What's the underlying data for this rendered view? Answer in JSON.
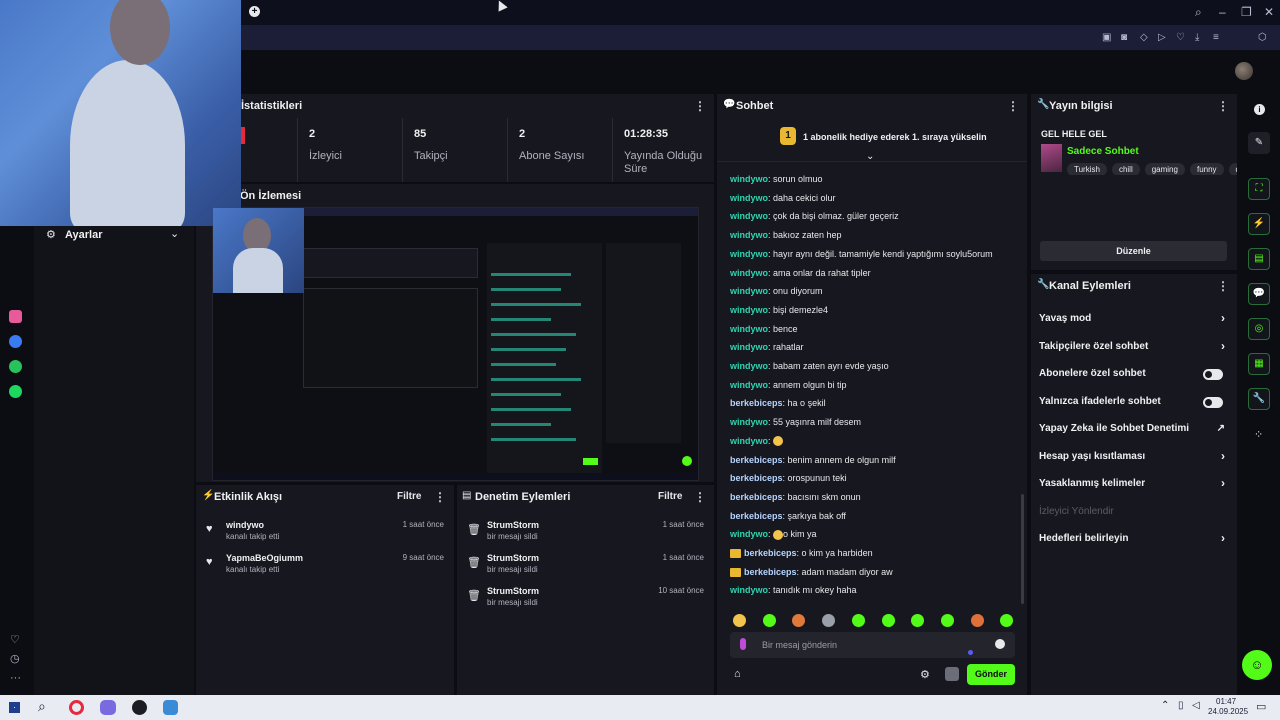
{
  "stats": {
    "title": "İstatistikleri",
    "items": [
      {
        "value": "2",
        "label": "İzleyici"
      },
      {
        "value": "85",
        "label": "Takipçi"
      },
      {
        "value": "2",
        "label": "Abone Sayısı"
      },
      {
        "value": "01:28:35",
        "label": "Yayında Olduğu Süre"
      }
    ]
  },
  "preview": {
    "title": "Ön İzlemesi"
  },
  "settings": {
    "label": "Ayarlar"
  },
  "activity": {
    "title": "Etkinlik Akışı",
    "filter": "Filtre",
    "items": [
      {
        "name": "windywo",
        "desc": "kanalı takip etti",
        "time": "1 saat önce"
      },
      {
        "name": "YapmaBeOgiumm",
        "desc": "kanalı takip etti",
        "time": "9 saat önce"
      }
    ]
  },
  "moderation": {
    "title": "Denetim Eylemleri",
    "filter": "Filtre",
    "items": [
      {
        "name": "StrumStorm",
        "desc": "bir mesajı sildi",
        "time": "1 saat önce"
      },
      {
        "name": "StrumStorm",
        "desc": "bir mesajı sildi",
        "time": "1 saat önce"
      },
      {
        "name": "StrumStorm",
        "desc": "bir mesajı sildi",
        "time": "10 saat önce"
      }
    ]
  },
  "chat": {
    "title": "Sohbet",
    "gift_banner": "1 abonelik hediye ederek 1. sıraya yükselin",
    "gift_rank": "1",
    "messages": [
      {
        "user": "windywo",
        "text": "sorun olmuo"
      },
      {
        "user": "windywo",
        "text": "daha cekici olur"
      },
      {
        "user": "windywo",
        "text": "çok da bişi olmaz. güler geçeriz"
      },
      {
        "user": "windywo",
        "text": "bakıoz zaten hep"
      },
      {
        "user": "windywo",
        "text": "hayır aynı değil. tamamiyle kendi yaptığımı soylu5orum"
      },
      {
        "user": "windywo",
        "text": "ama onlar da rahat tipler"
      },
      {
        "user": "windywo",
        "text": "onu diyorum"
      },
      {
        "user": "windywo",
        "text": "bişi demezle4"
      },
      {
        "user": "windywo",
        "text": "bence"
      },
      {
        "user": "windywo",
        "text": "rahatlar"
      },
      {
        "user": "windywo",
        "text": "babam zaten ayrı evde yaşıo"
      },
      {
        "user": "windywo",
        "text": "annem olgun bi tip"
      },
      {
        "user": "berkebiceps",
        "text": "ha o şekil"
      },
      {
        "user": "windywo",
        "text": "55 yaşınra milf desem"
      },
      {
        "user": "windywo",
        "text": ""
      },
      {
        "user": "berkebiceps",
        "text": "benim annem de olgun milf"
      },
      {
        "user": "berkebiceps",
        "text": "orospunun teki"
      },
      {
        "user": "berkebiceps",
        "text": "bacısını skm onun"
      },
      {
        "user": "berkebiceps",
        "text": "şarkıya bak off"
      },
      {
        "user": "windywo",
        "text": "o kim ya"
      },
      {
        "user": "berkebiceps",
        "text": "o kim ya harbiden"
      },
      {
        "user": "berkebiceps",
        "text": "adam madam diyor aw"
      },
      {
        "user": "windywo",
        "text": "tanıdık mı okey haha"
      }
    ],
    "input_placeholder": "Bir mesaj gönderin",
    "send_label": "Gönder"
  },
  "stream_info": {
    "title": "Yayın bilgisi",
    "stream_title": "GEL HELE GEL",
    "category": "Sadece Sohbet",
    "tags": [
      "Turkish",
      "chill",
      "gaming",
      "funny",
      "de"
    ],
    "edit_label": "Düzenle"
  },
  "channel_actions": {
    "title": "Kanal Eylemleri",
    "items": [
      {
        "label": "Yavaş mod",
        "control": "chevron"
      },
      {
        "label": "Takipçilere özel sohbet",
        "control": "chevron"
      },
      {
        "label": "Abonelere özel sohbet",
        "control": "toggle"
      },
      {
        "label": "Yalnızca ifadelerle sohbet",
        "control": "toggle"
      },
      {
        "label": "Yapay Zeka ile Sohbet Denetimi",
        "control": "external"
      },
      {
        "label": "Hesap yaşı kısıtlaması",
        "control": "chevron"
      },
      {
        "label": "Yasaklanmış kelimeler",
        "control": "chevron"
      },
      {
        "label": "İzleyici Yönlendir",
        "control": "disabled"
      },
      {
        "label": "Hedefleri belirleyin",
        "control": "chevron"
      }
    ]
  },
  "taskbar": {
    "time": "01:47",
    "date": "24.09.2025"
  },
  "colors": {
    "accent": "#53fc18",
    "chat_user": "#2fd4b0",
    "panel": "#17181f",
    "background": "#0c0d12"
  }
}
